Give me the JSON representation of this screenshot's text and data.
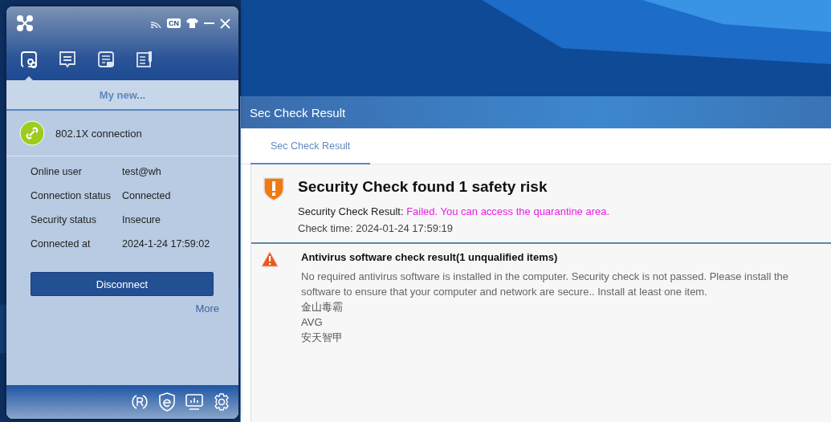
{
  "client": {
    "language_badge": "CN",
    "tabs": [
      {
        "selected": true
      },
      {
        "selected": false
      },
      {
        "selected": false
      },
      {
        "selected": false
      }
    ],
    "section_title": "My new...",
    "connection": {
      "name": "802.1X connection"
    },
    "details": [
      {
        "label": "Online user",
        "value": "test@wh"
      },
      {
        "label": "Connection status",
        "value": "Connected"
      },
      {
        "label": "Security status",
        "value": "Insecure"
      },
      {
        "label": "Connected at",
        "value": "2024-1-24 17:59:02"
      }
    ],
    "disconnect_button": "Disconnect",
    "more_link": "More"
  },
  "sec_window": {
    "title": "Sec Check Result",
    "tabs": [
      {
        "label": "Sec Check Result",
        "selected": true
      }
    ],
    "summary": {
      "title": "Security Check found 1 safety risk",
      "result_label": "Security Check Result:",
      "result_value": "Failed. You can access the quarantine area.",
      "check_time": "Check time: 2024-01-24 17:59:19"
    },
    "items": [
      {
        "title": "Antivirus software check result(1 unqualified items)",
        "description": "No required antivirus software is installed in the computer. Security check is not passed. Please install the software to ensure that your computer and network are secure.. Install at least one item.",
        "software": [
          "金山毒霸",
          "AVG",
          "安天智甲"
        ]
      }
    ]
  }
}
